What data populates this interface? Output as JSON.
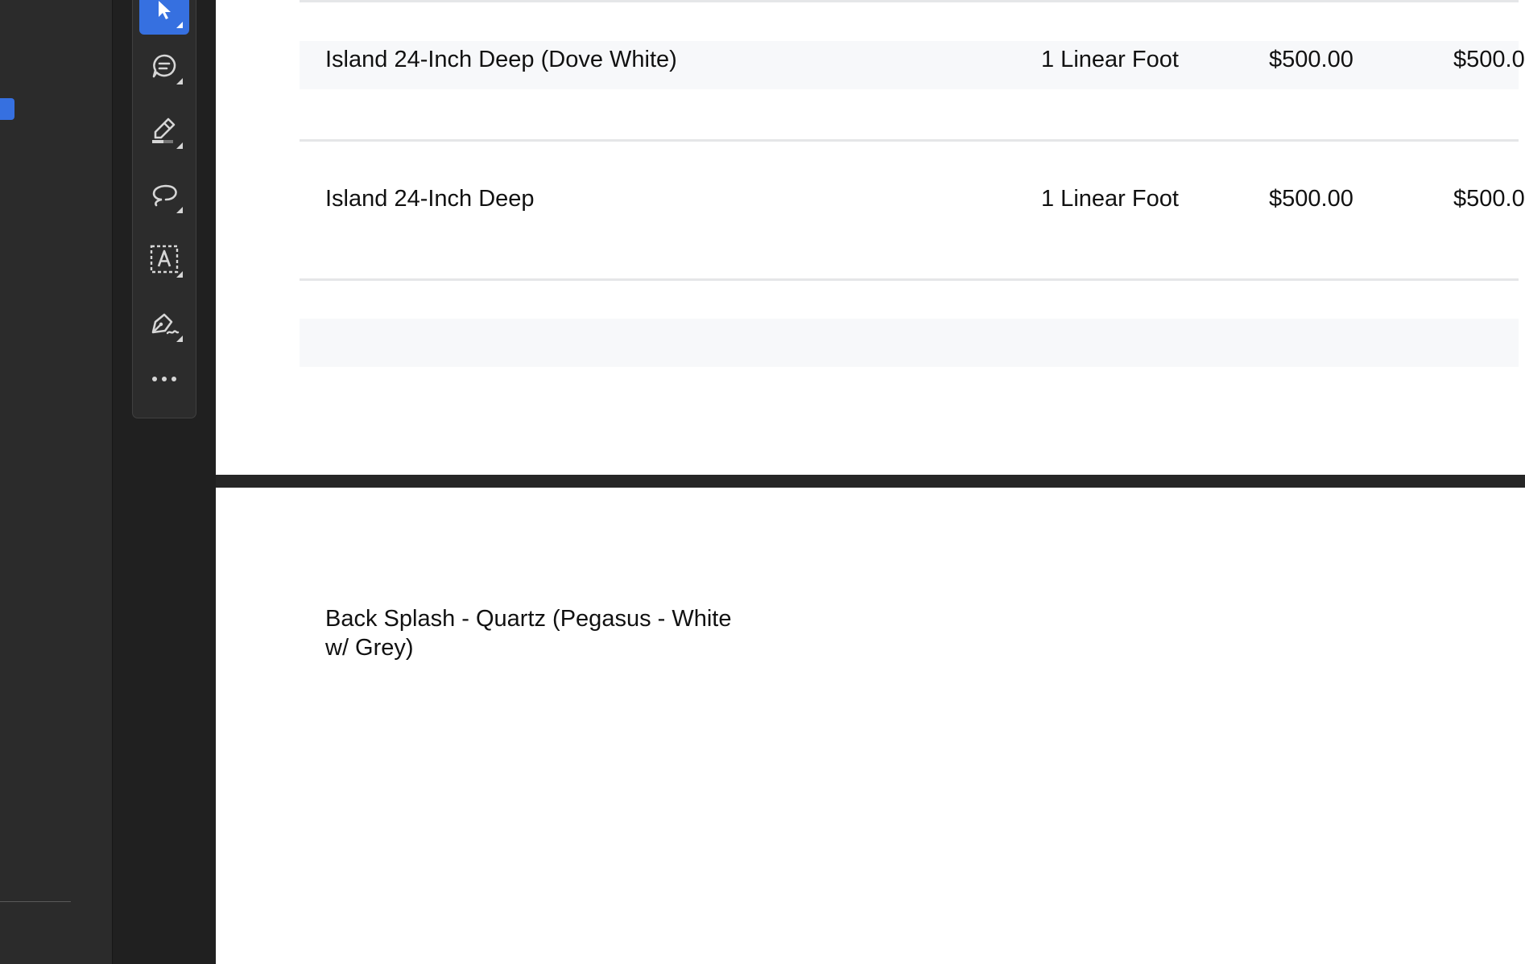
{
  "toolbar": {
    "tools": [
      {
        "id": "select",
        "icon": "select-arrow-icon",
        "active": true
      },
      {
        "id": "comment",
        "icon": "comment-icon",
        "active": false
      },
      {
        "id": "highlight",
        "icon": "highlighter-pen-icon",
        "active": false
      },
      {
        "id": "draw",
        "icon": "freehand-draw-icon",
        "active": false
      },
      {
        "id": "text",
        "icon": "text-box-icon",
        "active": false
      },
      {
        "id": "sign",
        "icon": "signature-pen-icon",
        "active": false
      },
      {
        "id": "more",
        "icon": "more-options-icon",
        "active": false
      }
    ],
    "accent_color": "#3670e0"
  },
  "document": {
    "rows": [
      {
        "description": "Island 24-Inch Deep (Dove White)",
        "quantity": "1 Linear Foot",
        "rate": "$500.00",
        "amount": "$500.0"
      },
      {
        "description": "Island 24-Inch Deep",
        "quantity": "1 Linear Foot",
        "rate": "$500.00",
        "amount": "$500.0"
      }
    ],
    "page2_item": "Back Splash - Quartz (Pegasus - White w/ Grey)"
  }
}
